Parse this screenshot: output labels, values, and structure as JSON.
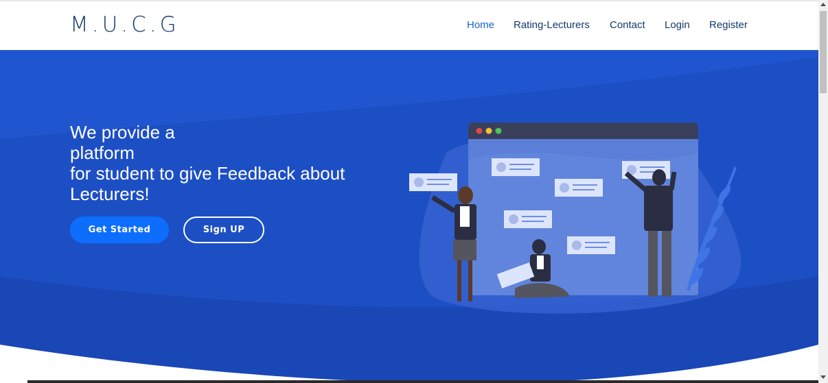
{
  "header": {
    "logo": "M.U.C.G",
    "nav": [
      {
        "label": "Home",
        "active": true
      },
      {
        "label": "Rating-Lecturers",
        "active": false
      },
      {
        "label": "Contact",
        "active": false
      },
      {
        "label": "Login",
        "active": false
      },
      {
        "label": "Register",
        "active": false
      }
    ]
  },
  "hero": {
    "headline_lines": [
      "We provide a",
      "platform",
      "for student to give Feedback about",
      "Lecturers!"
    ],
    "primary_button": "Get Started",
    "secondary_button": "Sign UP"
  },
  "colors": {
    "hero_background": "#1d4fc4",
    "brand_text": "#123a6b",
    "active_nav": "#1466c8",
    "primary_button": "#0d6efd"
  },
  "icons": [
    "browser-window-icon",
    "feedback-card-icon",
    "leaf-plant-icon"
  ]
}
